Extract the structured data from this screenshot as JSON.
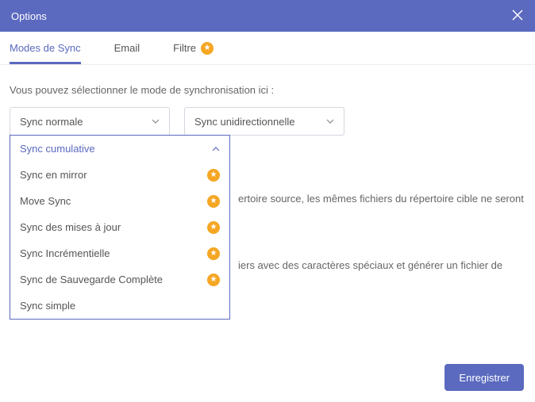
{
  "window": {
    "title": "Options"
  },
  "tabs": {
    "modes": "Modes de Sync",
    "email": "Email",
    "filtre": "Filtre"
  },
  "instruction": "Vous pouvez sélectionner le mode de synchronisation ici :",
  "select_left": {
    "value": "Sync normale"
  },
  "select_right": {
    "value": "Sync unidirectionnelle"
  },
  "dropdown": {
    "selected": "Sync cumulative",
    "options": {
      "mirror": "Sync en mirror",
      "move": "Move Sync",
      "updates": "Sync des mises à jour",
      "incremental": "Sync Incrémentielle",
      "backup": "Sync de Sauvegarde Complète",
      "simple": "Sync simple"
    }
  },
  "background_text": {
    "line1": "ertoire source, les mêmes fichiers du répertoire cible ne seront",
    "line2": "iers avec des caractères spéciaux et générer un fichier de"
  },
  "footer": {
    "save": "Enregistrer"
  }
}
